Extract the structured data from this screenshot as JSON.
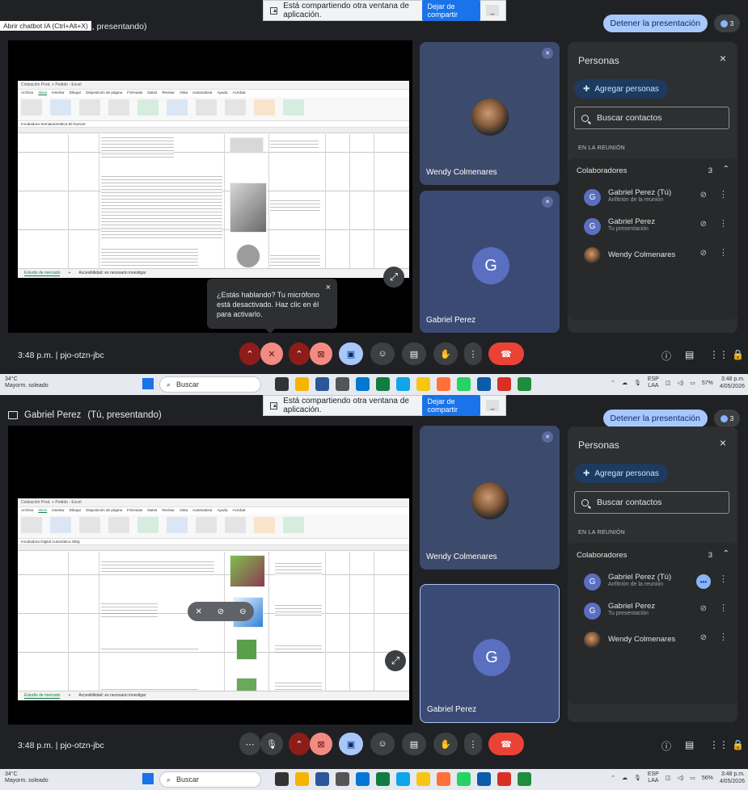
{
  "share_bar": {
    "message": "Está compartiendo otra ventana de aplicación.",
    "stop_label": "Dejar de compartir",
    "minimize": "_"
  },
  "screens": [
    {
      "presenter_title": "(Tú, presentando)",
      "tooltip": "Abrir chatbot IA (Ctrl+Alt+X)",
      "stop_presenting": "Detener la presentación",
      "participants_count": "3",
      "sheet": {
        "title": "Cotización Prod. + Pedido - Excel",
        "menu": [
          "Archivo",
          "Inicio",
          "Insertar",
          "Dibujar",
          "Disposición de página",
          "Fórmulas",
          "Datos",
          "Revisar",
          "Vista",
          "Automatizar",
          "Ayuda",
          "Acrobat"
        ],
        "formula": "Incubadora Semiautomática 50 huevos",
        "tabs": [
          "Estudio de mercado",
          "+"
        ],
        "status": "Accesibilidad: es necesario investigar"
      },
      "tiles": [
        {
          "name": "Wendy Colmenares"
        },
        {
          "name": "Gabriel Perez",
          "initial": "G"
        }
      ],
      "bubble": {
        "text": "¿Estás hablando? Tu micrófono está desactivado. Haz clic en él para activarlo.",
        "close": "×"
      },
      "clock": "3:48 p.m.",
      "separator": "|",
      "meeting_code": "pjo-otzn-jbc"
    },
    {
      "presenter_name": "Gabriel Perez",
      "presenter_title": "(Tú, presentando)",
      "stop_presenting": "Detener la presentación",
      "participants_count": "3",
      "sheet": {
        "title": "Cotización Prod. + Pedido - Excel",
        "menu": [
          "Archivo",
          "Inicio",
          "Insertar",
          "Dibujar",
          "Disposición de página",
          "Fórmulas",
          "Datos",
          "Revisar",
          "Vista",
          "Automatizar",
          "Ayuda",
          "Acrobat"
        ],
        "formula": "Incubadora Digital Automática 300g",
        "tabs": [
          "Estudio de mercado",
          "+"
        ],
        "status": "Accesibilidad: es necesario investigar"
      },
      "tiles": [
        {
          "name": "Wendy Colmenares"
        },
        {
          "name": "Gabriel Perez",
          "initial": "G"
        }
      ],
      "clock": "3:48 p.m.",
      "separator": "|",
      "meeting_code": "pjo-otzn-jbc"
    }
  ],
  "people_panel": {
    "title": "Personas",
    "close": "×",
    "add_label": "Agregar personas",
    "search_placeholder": "Buscar contactos",
    "section_label": "EN LA REUNIÓN",
    "group_label": "Colaboradores",
    "group_count": "3",
    "people": [
      {
        "name": "Gabriel Perez (Tú)",
        "role": "Anfitrión de la reunión",
        "initial": "G"
      },
      {
        "name": "Gabriel Perez",
        "role": "Tu presentación",
        "initial": "G"
      },
      {
        "name": "Wendy Colmenares",
        "role": ""
      }
    ]
  },
  "taskbar": [
    {
      "temp": "34°C",
      "weather": "Mayorm. soleado",
      "search": "Buscar",
      "lang1": "ESP",
      "lang2": "LAA",
      "battery": "57%",
      "time": "3:48 p.m.",
      "date": "4/05/2026"
    },
    {
      "temp": "34°C",
      "weather": "Mayorm. soleado",
      "search": "Buscar",
      "lang1": "ESP",
      "lang2": "LAA",
      "battery": "56%",
      "time": "3:48 p.m.",
      "date": "4/05/2026"
    }
  ],
  "colors": {
    "stop_pres_bg": "#a8c7fa",
    "end_call": "#ea4335",
    "muted": "#f28b82",
    "panel": "#2d2f31"
  }
}
